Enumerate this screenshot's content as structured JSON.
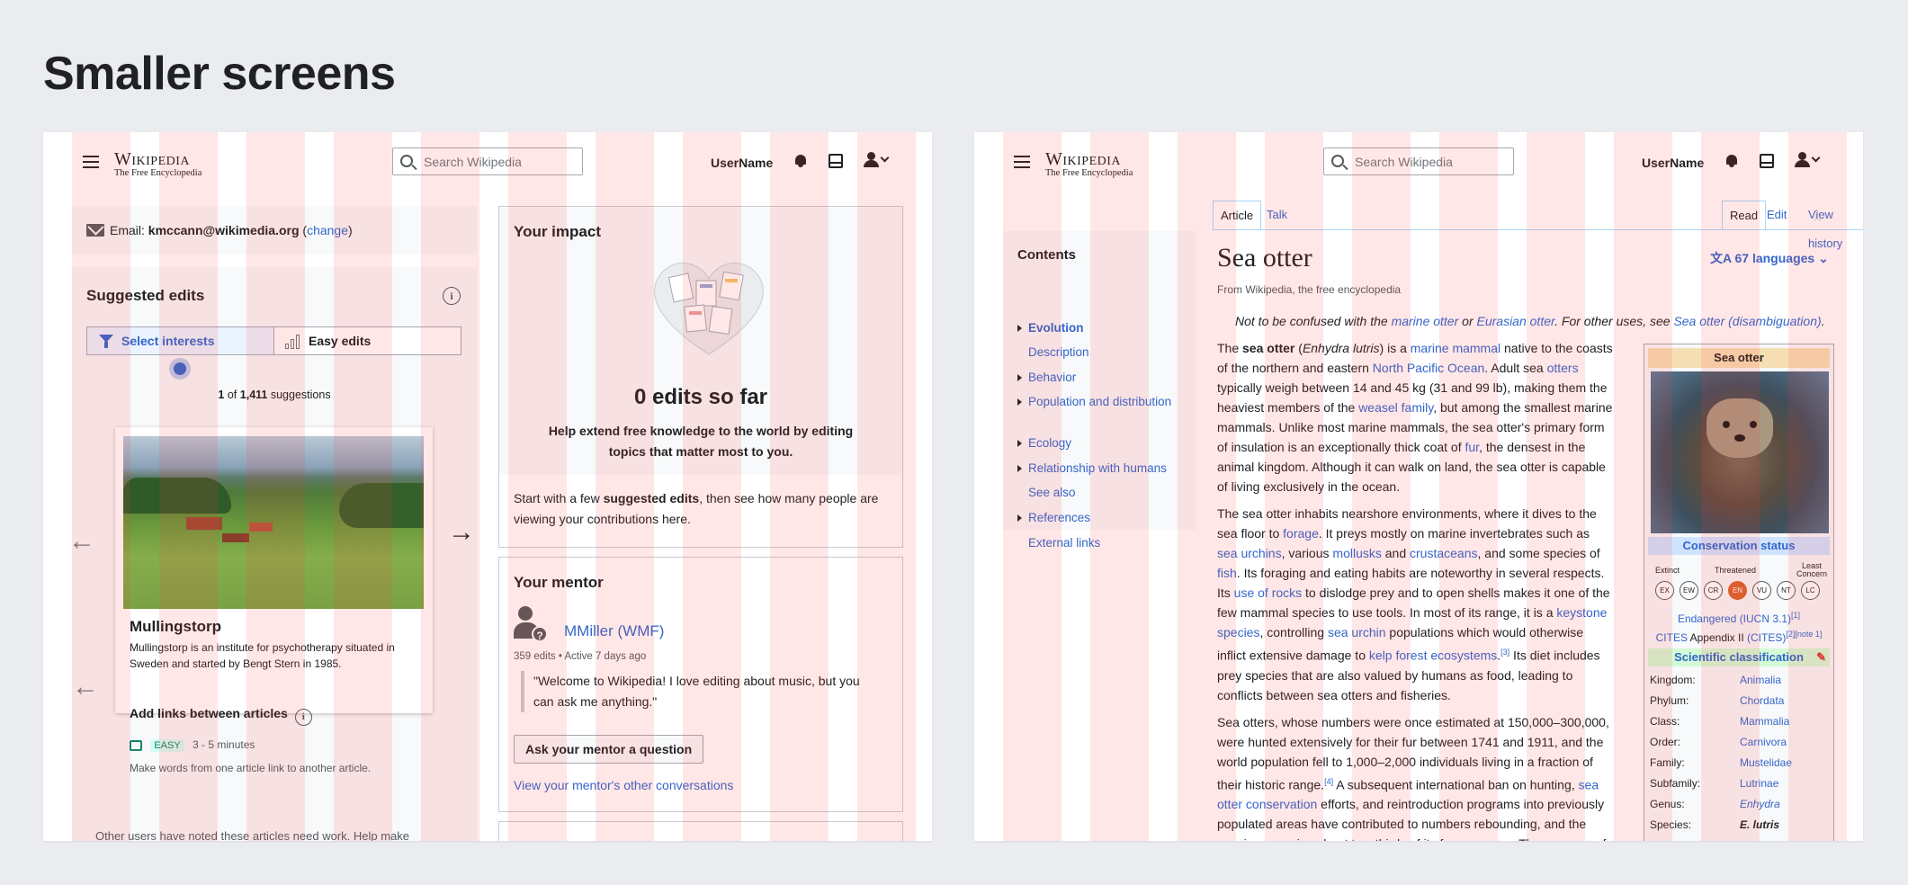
{
  "page_title": "Smaller screens",
  "common": {
    "logo_wordmark": "Wikipedia",
    "logo_tagline": "The Free Encyclopedia",
    "search_placeholder": "Search Wikipedia",
    "username": "UserName"
  },
  "homepage": {
    "email_label": "Email:",
    "email_value": "kmccann@wikimedia.org",
    "email_change": "change",
    "suggested_title": "Suggested edits",
    "tab_interests": "Select interests",
    "tab_easy": "Easy edits",
    "count_current": "1",
    "count_of": "of",
    "count_total": "1,411",
    "count_suffix": "suggestions",
    "card_title": "Mullingstorp",
    "card_desc": "Mullingstorp is an institute for psychotherapy situated in Sweden and started by Bengt Stern in 1985.",
    "task_title": "Add links between articles",
    "task_difficulty": "EASY",
    "task_time": "3 - 5 minutes",
    "task_desc": "Make words from one article link to another article.",
    "bottom_note": "Other users have noted these articles need work. Help make",
    "impact_title": "Your impact",
    "impact_count": "0 edits so far",
    "impact_help": "Help extend free knowledge to the world by editing topics that matter most to you.",
    "impact_start_pre": "Start with a few ",
    "impact_start_bold": "suggested edits",
    "impact_start_post": ", then see how many people are viewing your contributions here.",
    "mentor_title": "Your mentor",
    "mentor_name": "MMiller (WMF)",
    "mentor_meta": "359 edits • Active 7 days ago",
    "mentor_quote": "\"Welcome to Wikipedia! I love editing about music, but you can ask me anything.\"",
    "mentor_ask": "Ask your mentor a question",
    "mentor_view": "View your mentor's other conversations"
  },
  "article": {
    "tab_article": "Article",
    "tab_talk": "Talk",
    "tab_read": "Read",
    "tab_edit": "Edit",
    "tab_history": "View history",
    "title": "Sea otter",
    "languages": "67 languages",
    "from": "From Wikipedia, the free encyclopedia",
    "hatnote_pre": "Not to be confused with the ",
    "hatnote_l1": "marine otter",
    "hatnote_or": " or ",
    "hatnote_l2": "Eurasian otter",
    "hatnote_mid": ". For other uses, see ",
    "hatnote_l3": "Sea otter (disambiguation)",
    "hatnote_end": ".",
    "toc_title": "Contents",
    "toc": [
      {
        "label": "Evolution",
        "arrow": true,
        "bold": true
      },
      {
        "label": "Description",
        "arrow": false,
        "bold": false
      },
      {
        "label": "Behavior",
        "arrow": true,
        "bold": false
      },
      {
        "label": "Population and distribution",
        "arrow": true,
        "bold": false
      },
      {
        "label": "Ecology",
        "arrow": true,
        "bold": false
      },
      {
        "label": "Relationship with humans",
        "arrow": true,
        "bold": false
      },
      {
        "label": "See also",
        "arrow": false,
        "bold": false
      },
      {
        "label": "References",
        "arrow": true,
        "bold": false
      },
      {
        "label": "External links",
        "arrow": false,
        "bold": false
      }
    ],
    "p1": "The <b>sea otter</b> (<i>Enhydra lutris</i>) is a <a>marine mammal</a> native to the coasts of the northern and eastern <a>North Pacific Ocean</a>. Adult sea <a>otters</a> typically weigh between 14 and 45 kg (31 and 99 lb), making them the heaviest members of the <a>weasel family</a>, but among the smallest marine mammals. Unlike most marine mammals, the sea otter's primary form of insulation is an exceptionally thick coat of <a>fur</a>, the densest in the animal kingdom. Although it can walk on land, the sea otter is capable of living exclusively in the ocean.",
    "p2": "The sea otter inhabits nearshore environments, where it dives to the sea floor to <a>forage</a>. It preys mostly on marine invertebrates such as <a>sea urchins</a>, various <a>mollusks</a> and <a>crustaceans</a>, and some species of <a>fish</a>. Its foraging and eating habits are noteworthy in several respects. Its <a>use of rocks</a> to dislodge prey and to open shells makes it one of the few mammal species to use tools. In most of its range, it is a <a>keystone species</a>, controlling <a>sea urchin</a> populations which would otherwise inflict extensive damage to <a>kelp forest ecosystems</a>.<sup><a>[3]</a></sup> Its diet includes prey species that are also valued by humans as food, leading to conflicts between sea otters and fisheries.",
    "p3": "Sea otters, whose numbers were once estimated at 150,000–300,000, were hunted extensively for their fur between 1741 and 1911, and the world population fell to 1,000–2,000 individuals living in a fraction of their historic range.<sup><a>[4]</a></sup> A subsequent international ban on hunting, <a>sea otter conservation</a> efforts, and reintroduction programs into previously populated areas have contributed to numbers rebounding, and the species occupies about two-thirds of its former range. The recovery of",
    "infobox": {
      "title": "Sea otter",
      "conservation": "Conservation status",
      "scale_left": "Extinct",
      "scale_mid": "Threatened",
      "scale_right": "Least Concern",
      "codes": [
        "EX",
        "EW",
        "CR",
        "EN",
        "VU",
        "NT",
        "LC"
      ],
      "status": "Endangered",
      "status_src": "(IUCN 3.1)",
      "status_ref": "[1]",
      "cites_pre": "CITES",
      "cites_text": " Appendix II ",
      "cites_link": "(CITES)",
      "cites_refs": "[2][note 1]",
      "sci_class": "Scientific classification",
      "taxonomy": [
        {
          "k": "Kingdom:",
          "v": "Animalia"
        },
        {
          "k": "Phylum:",
          "v": "Chordata"
        },
        {
          "k": "Class:",
          "v": "Mammalia"
        },
        {
          "k": "Order:",
          "v": "Carnivora"
        },
        {
          "k": "Family:",
          "v": "Mustelidae"
        },
        {
          "k": "Subfamily:",
          "v": "Lutrinae"
        },
        {
          "k": "Genus:",
          "v": "Enhydra"
        },
        {
          "k": "Species:",
          "v": "E. lutris"
        }
      ]
    }
  }
}
